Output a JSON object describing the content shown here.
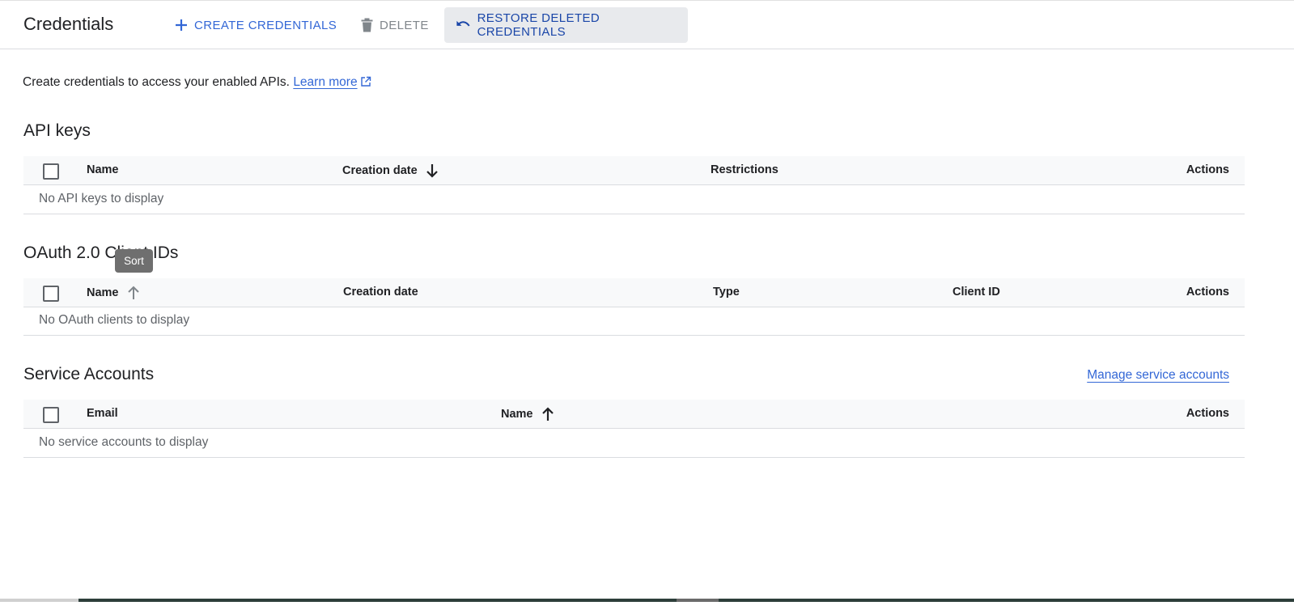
{
  "header": {
    "title": "Credentials",
    "create_label": "CREATE CREDENTIALS",
    "delete_label": "DELETE",
    "restore_label": "RESTORE DELETED CREDENTIALS"
  },
  "intro": {
    "text": "Create credentials to access your enabled APIs.",
    "link": "Learn more"
  },
  "api_keys": {
    "title": "API keys",
    "columns": [
      "Name",
      "Creation date",
      "Restrictions",
      "Actions"
    ],
    "empty": "No API keys to display"
  },
  "oauth": {
    "title": "OAuth 2.0 Client IDs",
    "columns": [
      "Name",
      "Creation date",
      "Type",
      "Client ID",
      "Actions"
    ],
    "empty": "No OAuth clients to display"
  },
  "service_accounts": {
    "title": "Service Accounts",
    "manage_link": "Manage service accounts",
    "columns": [
      "Email",
      "Name",
      "Actions"
    ],
    "empty": "No service accounts to display"
  },
  "tooltip": {
    "text": "Sort"
  },
  "colors": {
    "accent": "#3367d6",
    "header_bg": "#f8f9fa",
    "restore_bg": "#e8eaed"
  }
}
